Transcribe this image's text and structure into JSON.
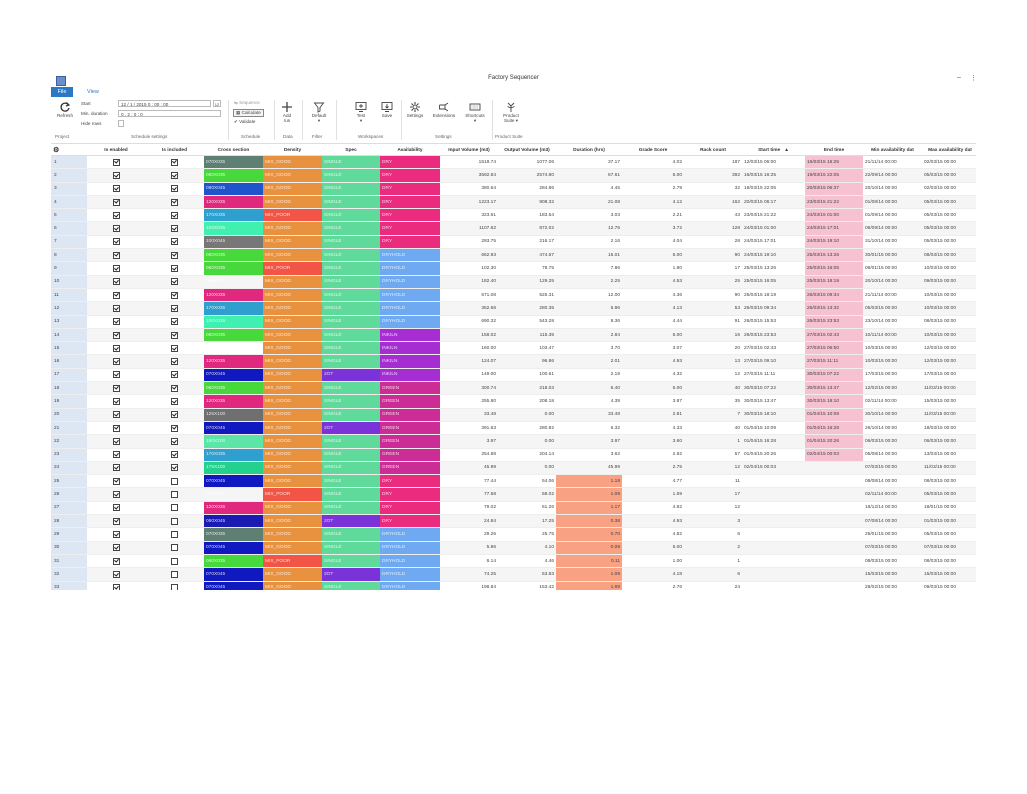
{
  "window": {
    "title": "Factory Sequencer",
    "minimize": "–",
    "more": "⋮"
  },
  "tabs": {
    "file": "File",
    "view": "View"
  },
  "project": {
    "refresh_label": "Refresh",
    "group_label": "Project"
  },
  "schedule": {
    "start_label": "Start",
    "start_value": "12 / 1 / 2015   0 : 00 : 00",
    "calendar_value": "12",
    "min_duration_label": "Min. duration",
    "min_duration_value": "0 . 2 : 0 : 0",
    "hide_rows_label": "Hide rows",
    "group_label": "Schedule settings",
    "sequence_label": "Sequence",
    "calculate_label": "Calculate",
    "validate_label": "Validate",
    "schedule_group_label": "Schedule"
  },
  "data": {
    "add_run_line1": "Add",
    "add_run_line2": "run",
    "group_label": "Data"
  },
  "filter": {
    "default_label": "Default",
    "group_label": "Filter"
  },
  "workspaces": {
    "test_label": "Test",
    "save_label": "Save",
    "group_label": "Workspaces"
  },
  "settings": {
    "settings_label": "Settings",
    "extensions_label": "Extensions",
    "shortcuts_label": "Shortcuts",
    "group_label": "Settings"
  },
  "product_suite": {
    "label_line1": "Product",
    "label_line2": "Suite",
    "group_label": "Product Suite"
  },
  "columns": [
    "Is enabled",
    "Is included",
    "Cross section",
    "Density",
    "Spec",
    "Availability",
    "Input Volume (m3)",
    "Output Volume (m3)",
    "Duration (hrs)",
    "Grade Score",
    "Rack count",
    "Start time",
    "End time",
    "Min availability dat",
    "Max availability dat"
  ],
  "sort_indicator": "▲",
  "colors": {
    "cross": {
      "070X035": "#5f7f73",
      "060X035": "#47d93b",
      "080X045": "#1f55cc",
      "120X035": "#e0287f",
      "170X035": "#2e9fcf",
      "100X035": "#3ff0b0",
      "100X045": "#777777",
      "125X100": "#6f6f6f",
      "150X100": "#5ce5a6",
      "175X100": "#23d08d",
      "070X045": "#1018c0",
      "060X045": "#1b1bb3",
      "070X025": "#3c92c0"
    },
    "density": {
      "MIX_GOOD": "#e8913e",
      "MIX_POOR": "#f25545"
    },
    "spec": {
      "SINGLE": "#5fda9a",
      "2OT": "#7a32d9"
    },
    "availability": {
      "DRY": "#eb2b7e",
      "DRYHOLD": "#6ea9f2",
      "INKILN": "#a52dd1",
      "GREEN": "#cc2c95"
    }
  },
  "rows": [
    {
      "n": "1",
      "en": true,
      "inc": true,
      "cross": "070X035",
      "dens": "MIX_GOOD",
      "spec": "SINGLE",
      "avail": "DRY",
      "in": "1518.74",
      "out": "1077.06",
      "dur": "37.17",
      "grade": "4.02",
      "rack": "187",
      "start": "12/03/15 06:00",
      "end": "16/03/15 16:25",
      "min": "21/11/14 00:00",
      "max": "02/03/15 00:00"
    },
    {
      "n": "2",
      "en": true,
      "inc": true,
      "cross": "060X035",
      "dens": "MIX_GOOD",
      "spec": "SINGLE",
      "avail": "DRY",
      "in": "3592.84",
      "out": "2574.80",
      "dur": "67.61",
      "grade": "5.00",
      "rack": "392",
      "start": "16/03/15 16:25",
      "end": "19/03/15 22:05",
      "min": "22/09/14 00:00",
      "max": "05/03/15 00:00"
    },
    {
      "n": "3",
      "en": true,
      "inc": true,
      "cross": "080X045",
      "dens": "MIX_GOOD",
      "spec": "SINGLE",
      "avail": "DRY",
      "in": "380.64",
      "out": "284.86",
      "dur": "4.45",
      "grade": "2.79",
      "rack": "32",
      "start": "19/03/15 22:05",
      "end": "20/03/15 06:37",
      "min": "20/10/14 00:00",
      "max": "02/03/15 00:00"
    },
    {
      "n": "4",
      "en": true,
      "inc": true,
      "cross": "120X035",
      "dens": "MIX_GOOD",
      "spec": "SINGLE",
      "avail": "DRY",
      "in": "1223.17",
      "out": "908.32",
      "dur": "21.08",
      "grade": "4.12",
      "rack": "162",
      "start": "20/03/15 06:17",
      "end": "23/03/15 21:22",
      "min": "01/08/14 00:00",
      "max": "05/03/15 00:00"
    },
    {
      "n": "5",
      "en": true,
      "inc": true,
      "cross": "170X035",
      "dens": "MIX_POOR",
      "spec": "SINGLE",
      "avail": "DRY",
      "in": "323.61",
      "out": "183.54",
      "dur": "3.03",
      "grade": "2.21",
      "rack": "43",
      "start": "23/03/15 21:22",
      "end": "24/03/15 01:00",
      "min": "01/09/14 00:00",
      "max": "05/03/15 00:00"
    },
    {
      "n": "6",
      "en": true,
      "inc": true,
      "cross": "100X035",
      "dens": "MIX_GOOD",
      "spec": "SINGLE",
      "avail": "DRY",
      "in": "1107.62",
      "out": "872.02",
      "dur": "12.76",
      "grade": "3.72",
      "rack": "128",
      "start": "24/03/15 01:00",
      "end": "24/03/15 17:01",
      "min": "06/09/14 00:00",
      "max": "05/03/15 00:00"
    },
    {
      "n": "7",
      "en": true,
      "inc": true,
      "cross": "100X045",
      "dens": "MIX_GOOD",
      "spec": "SINGLE",
      "avail": "DRY",
      "in": "293.75",
      "out": "216.17",
      "dur": "2.16",
      "grade": "4.04",
      "rack": "28",
      "start": "24/03/15 17:01",
      "end": "24/03/15 19:10",
      "min": "31/10/14 00:00",
      "max": "05/03/15 00:00"
    },
    {
      "n": "8",
      "en": true,
      "inc": true,
      "cross": "060X035",
      "dens": "MIX_GOOD",
      "spec": "SINGLE",
      "avail": "DRYHOLD",
      "in": "662.93",
      "out": "474.67",
      "dur": "15.01",
      "grade": "5.00",
      "rack": "90",
      "start": "24/03/15 19:10",
      "end": "25/03/15 13:26",
      "min": "30/01/15 00:00",
      "max": "08/03/15 00:00"
    },
    {
      "n": "9",
      "en": true,
      "inc": true,
      "cross": "060X035",
      "dens": "MIX_POOR",
      "spec": "SINGLE",
      "avail": "DRYHOLD",
      "in": "102.30",
      "out": "78.75",
      "dur": "7.86",
      "grade": "1.80",
      "rack": "17",
      "start": "25/03/15 13:26",
      "end": "25/03/15 16:05",
      "min": "08/01/15 00:00",
      "max": "10/03/15 00:00"
    },
    {
      "n": "10",
      "en": true,
      "inc": true,
      "cross": "080X035",
      "dens": "MIX_GOOD",
      "spec": "SINGLE",
      "avail": "DRYHOLD",
      "in": "182.40",
      "out": "129.25",
      "dur": "2.25",
      "grade": "4.53",
      "rack": "25",
      "start": "25/03/15 16:05",
      "end": "25/03/15 18:19",
      "min": "20/10/14 00:00",
      "max": "09/03/15 00:00"
    },
    {
      "n": "11",
      "en": true,
      "inc": true,
      "cross": "120X035",
      "dens": "MIX_GOOD",
      "spec": "SINGLE",
      "avail": "DRYHOLD",
      "in": "671.08",
      "out": "525.31",
      "dur": "12.00",
      "grade": "4.36",
      "rack": "90",
      "start": "25/03/15 18:19",
      "end": "26/03/15 09:34",
      "min": "21/11/14 00:00",
      "max": "10/03/15 00:00"
    },
    {
      "n": "12",
      "en": true,
      "inc": true,
      "cross": "170X035",
      "dens": "MIX_GOOD",
      "spec": "SINGLE",
      "avail": "DRYHOLD",
      "in": "352.68",
      "out": "280.35",
      "dur": "5.96",
      "grade": "4.13",
      "rack": "53",
      "start": "26/03/15 09:34",
      "end": "26/03/15 13:32",
      "min": "05/03/15 00:00",
      "max": "10/03/15 00:00"
    },
    {
      "n": "13",
      "en": true,
      "inc": true,
      "cross": "100X035",
      "dens": "MIX_GOOD",
      "spec": "SINGLE",
      "avail": "DRYHOLD",
      "in": "690.32",
      "out": "543.28",
      "dur": "8.36",
      "grade": "4.44",
      "rack": "91",
      "start": "26/03/15 15:53",
      "end": "26/03/15 23:53",
      "min": "23/10/14 00:00",
      "max": "08/03/15 00:00"
    },
    {
      "n": "14",
      "en": true,
      "inc": true,
      "cross": "060X035",
      "dens": "MIX_GOOD",
      "spec": "SINGLE",
      "avail": "INKILN",
      "in": "158.02",
      "out": "115.35",
      "dur": "2.84",
      "grade": "5.00",
      "rack": "16",
      "start": "26/03/15 23:53",
      "end": "27/03/15 02:43",
      "min": "10/11/14 00:00",
      "max": "10/03/15 00:00"
    },
    {
      "n": "15",
      "en": true,
      "inc": true,
      "cross": "080X035",
      "dens": "MIX_GOOD",
      "spec": "SINGLE",
      "avail": "INKILN",
      "in": "160.00",
      "out": "103.47",
      "dur": "3.70",
      "grade": "3.07",
      "rack": "20",
      "start": "27/03/15 02:43",
      "end": "27/03/15 06:50",
      "min": "10/03/15 00:00",
      "max": "12/03/15 00:00"
    },
    {
      "n": "16",
      "en": true,
      "inc": true,
      "cross": "120X035",
      "dens": "MIX_GOOD",
      "spec": "SINGLE",
      "avail": "INKILN",
      "in": "124.07",
      "out": "96.86",
      "dur": "2.01",
      "grade": "4.93",
      "rack": "13",
      "start": "27/03/15 09:10",
      "end": "27/03/15 11:11",
      "min": "10/03/15 00:00",
      "max": "12/03/15 00:00"
    },
    {
      "n": "17",
      "en": true,
      "inc": true,
      "cross": "070X045",
      "dens": "MIX_GOOD",
      "spec": "2OT",
      "avail": "INKILN",
      "in": "149.00",
      "out": "100.61",
      "dur": "2.19",
      "grade": "4.32",
      "rack": "12",
      "start": "27/03/15 11:11",
      "end": "30/03/15 07:22",
      "min": "17/03/15 00:00",
      "max": "17/03/15 00:00"
    },
    {
      "n": "18",
      "en": true,
      "inc": true,
      "cross": "060X035",
      "dens": "MIX_GOOD",
      "spec": "SINGLE",
      "avail": "GREEN",
      "in": "300.74",
      "out": "218.03",
      "dur": "6.40",
      "grade": "5.00",
      "rack": "40",
      "start": "30/03/15 07:22",
      "end": "30/03/15 13:47",
      "min": "12/02/15 00:00",
      "max": "11/03/15 00:00"
    },
    {
      "n": "19",
      "en": true,
      "inc": true,
      "cross": "120X035",
      "dens": "MIX_GOOD",
      "spec": "SINGLE",
      "avail": "GREEN",
      "in": "255.80",
      "out": "208.18",
      "dur": "4.39",
      "grade": "3.87",
      "rack": "35",
      "start": "30/03/15 13:47",
      "end": "30/03/15 18:10",
      "min": "02/11/14 00:00",
      "max": "15/03/15 00:00"
    },
    {
      "n": "20",
      "en": true,
      "inc": true,
      "cross": "125X100",
      "dens": "MIX_GOOD",
      "spec": "SINGLE",
      "avail": "GREEN",
      "in": "33.48",
      "out": "0.00",
      "dur": "33.48",
      "grade": "2.81",
      "rack": "7",
      "start": "30/03/15 18:10",
      "end": "01/04/15 10:09",
      "min": "30/10/14 00:00",
      "max": "11/03/15 00:00"
    },
    {
      "n": "21",
      "en": true,
      "inc": true,
      "cross": "070X045",
      "dens": "MIX_GOOD",
      "spec": "2OT",
      "avail": "GREEN",
      "in": "391.63",
      "out": "280.82",
      "dur": "6.32",
      "grade": "4.33",
      "rack": "40",
      "start": "01/04/15 10:09",
      "end": "01/04/15 16:28",
      "min": "26/10/14 00:00",
      "max": "18/03/15 00:00"
    },
    {
      "n": "22",
      "en": true,
      "inc": true,
      "cross": "150X100",
      "dens": "MIX_GOOD",
      "spec": "SINGLE",
      "avail": "GREEN",
      "in": "3.97",
      "out": "0.00",
      "dur": "3.97",
      "grade": "3.60",
      "rack": "1",
      "start": "01/04/15 16:28",
      "end": "01/04/15 20:26",
      "min": "06/03/15 00:00",
      "max": "06/03/15 00:00"
    },
    {
      "n": "23",
      "en": true,
      "inc": true,
      "cross": "170X035",
      "dens": "MIX_GOOD",
      "spec": "SINGLE",
      "avail": "GREEN",
      "in": "254.88",
      "out": "204.14",
      "dur": "3.62",
      "grade": "2.82",
      "rack": "57",
      "start": "01/04/15 20:26",
      "end": "02/04/15 00:03",
      "min": "05/08/14 00:00",
      "max": "13/03/15 00:00"
    },
    {
      "n": "24",
      "en": true,
      "inc": true,
      "cross": "175X100",
      "dens": "MIX_GOOD",
      "spec": "SINGLE",
      "avail": "GREEN",
      "in": "45.99",
      "out": "0.00",
      "dur": "45.99",
      "grade": "2.75",
      "rack": "12",
      "start": "02/04/15 00:03",
      "end": "",
      "min": "07/03/15 00:00",
      "max": "11/03/15 00:00"
    },
    {
      "n": "25",
      "en": true,
      "inc": false,
      "cross": "070X045",
      "dens": "MIX_GOOD",
      "spec": "SINGLE",
      "avail": "DRY",
      "in": "77.44",
      "out": "54.06",
      "dur": "1.18",
      "grade": "4.77",
      "rack": "11",
      "start": "",
      "end": "",
      "min": "08/08/14 00:00",
      "max": "08/03/15 00:00"
    },
    {
      "n": "26",
      "en": true,
      "inc": false,
      "cross": "080X035",
      "dens": "MIX_POOR",
      "spec": "SINGLE",
      "avail": "DRY",
      "in": "77.58",
      "out": "58.02",
      "dur": "1.09",
      "grade": "1.59",
      "rack": "17",
      "start": "",
      "end": "",
      "min": "02/11/14 00:00",
      "max": "05/03/15 00:00"
    },
    {
      "n": "27",
      "en": true,
      "inc": false,
      "cross": "120X035",
      "dens": "MIX_GOOD",
      "spec": "SINGLE",
      "avail": "DRY",
      "in": "79.02",
      "out": "61.26",
      "dur": "1.17",
      "grade": "4.82",
      "rack": "12",
      "start": "",
      "end": "",
      "min": "18/12/14 00:00",
      "max": "18/01/15 00:00"
    },
    {
      "n": "28",
      "en": true,
      "inc": false,
      "cross": "060X045",
      "dens": "MIX_GOOD",
      "spec": "2OT",
      "avail": "DRY",
      "in": "24.84",
      "out": "17.25",
      "dur": "0.38",
      "grade": "4.93",
      "rack": "3",
      "start": "",
      "end": "",
      "min": "07/08/14 00:00",
      "max": "01/03/15 00:00"
    },
    {
      "n": "29",
      "en": true,
      "inc": false,
      "cross": "070X035",
      "dens": "MIX_GOOD",
      "spec": "SINGLE",
      "avail": "DRYHOLD",
      "in": "29.26",
      "out": "25.75",
      "dur": "0.70",
      "grade": "4.82",
      "rack": "6",
      "start": "",
      "end": "",
      "min": "25/01/15 00:00",
      "max": "05/03/15 00:00"
    },
    {
      "n": "30",
      "en": true,
      "inc": false,
      "cross": "070X045",
      "dens": "MIX_GOOD",
      "spec": "SINGLE",
      "avail": "DRYHOLD",
      "in": "5.86",
      "out": "4.10",
      "dur": "0.09",
      "grade": "5.00",
      "rack": "2",
      "start": "",
      "end": "",
      "min": "07/03/15 00:00",
      "max": "07/03/15 00:00"
    },
    {
      "n": "31",
      "en": true,
      "inc": false,
      "cross": "060X035",
      "dens": "MIX_POOR",
      "spec": "SINGLE",
      "avail": "DRYHOLD",
      "in": "6.14",
      "out": "4.46",
      "dur": "0.11",
      "grade": "1.00",
      "rack": "1",
      "start": "",
      "end": "",
      "min": "08/03/15 00:00",
      "max": "08/03/15 00:00"
    },
    {
      "n": "32",
      "en": true,
      "inc": false,
      "cross": "070X045",
      "dens": "MIX_GOOD",
      "spec": "2OT",
      "avail": "DRYHOLD",
      "in": "74.25",
      "out": "53.83",
      "dur": "1.09",
      "grade": "4.18",
      "rack": "6",
      "start": "",
      "end": "",
      "min": "15/03/15 00:00",
      "max": "15/03/15 00:00"
    },
    {
      "n": "33",
      "en": true,
      "inc": false,
      "cross": "070X045",
      "dens": "MIX_GOOD",
      "spec": "SINGLE",
      "avail": "DRYHOLD",
      "in": "198.84",
      "out": "153.42",
      "dur": "1.69",
      "grade": "2.76",
      "rack": "24",
      "start": "",
      "end": "",
      "min": "28/02/15 00:00",
      "max": "09/03/15 00:00"
    }
  ]
}
